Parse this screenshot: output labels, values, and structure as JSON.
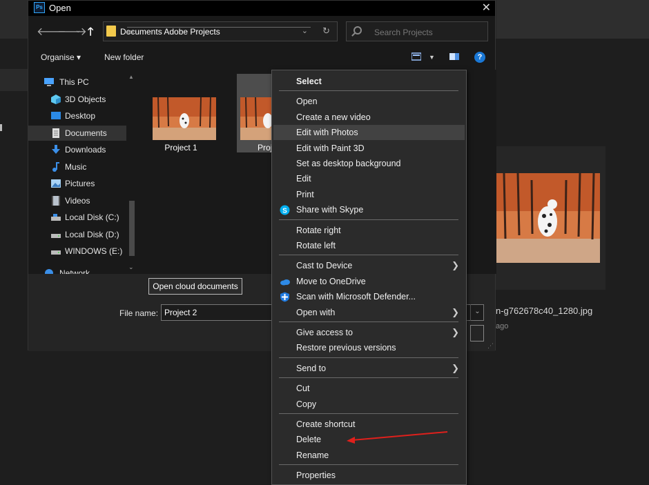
{
  "dialog": {
    "title": "Open",
    "close_symbol": "✕",
    "breadcrumb": [
      "Documents",
      "Adobe",
      "Projects"
    ],
    "crumb_prefix": "«",
    "search_placeholder": "Search Projects",
    "organise_label": "Organise ▾",
    "new_folder_label": "New folder",
    "help_symbol": "?",
    "nav_items": [
      {
        "label": "This PC",
        "icon": "computer-icon"
      },
      {
        "label": "3D Objects",
        "icon": "cube-icon"
      },
      {
        "label": "Desktop",
        "icon": "desktop-icon"
      },
      {
        "label": "Documents",
        "icon": "document-icon",
        "selected": true
      },
      {
        "label": "Downloads",
        "icon": "download-icon"
      },
      {
        "label": "Music",
        "icon": "music-icon"
      },
      {
        "label": "Pictures",
        "icon": "pictures-icon"
      },
      {
        "label": "Videos",
        "icon": "video-icon"
      },
      {
        "label": "Local Disk (C:)",
        "icon": "drive-icon"
      },
      {
        "label": "Local Disk (D:)",
        "icon": "drive-icon"
      },
      {
        "label": "WINDOWS (E:)",
        "icon": "drive-icon"
      },
      {
        "label": "Network",
        "icon": "network-icon"
      }
    ],
    "files": [
      {
        "name": "Project 1"
      },
      {
        "name": "Proj"
      }
    ],
    "cloud_button": "Open cloud documents",
    "file_name_label": "File name:",
    "file_name_value": "Project 2"
  },
  "context_menu": {
    "groups": [
      [
        {
          "label": "Select",
          "bold": true
        }
      ],
      [
        {
          "label": "Open"
        },
        {
          "label": "Create a new video"
        },
        {
          "label": "Edit with Photos",
          "highlighted": true
        },
        {
          "label": "Edit with Paint 3D"
        },
        {
          "label": "Set as desktop background"
        },
        {
          "label": "Edit"
        },
        {
          "label": "Print"
        },
        {
          "label": "Share with Skype",
          "icon": "skype-icon"
        }
      ],
      [
        {
          "label": "Rotate right"
        },
        {
          "label": "Rotate left"
        }
      ],
      [
        {
          "label": "Cast to Device",
          "submenu": true
        },
        {
          "label": "Move to OneDrive",
          "icon": "onedrive-icon"
        },
        {
          "label": "Scan with Microsoft Defender...",
          "icon": "defender-icon"
        },
        {
          "label": "Open with",
          "submenu": true
        }
      ],
      [
        {
          "label": "Give access to",
          "submenu": true
        },
        {
          "label": "Restore previous versions"
        }
      ],
      [
        {
          "label": "Send to",
          "submenu": true
        }
      ],
      [
        {
          "label": "Cut"
        },
        {
          "label": "Copy"
        }
      ],
      [
        {
          "label": "Create shortcut"
        },
        {
          "label": "Delete"
        },
        {
          "label": "Rename"
        }
      ],
      [
        {
          "label": "Properties"
        }
      ]
    ],
    "submenu_symbol": "❯"
  },
  "background": {
    "file_name": "n-g762678c40_1280.jpg",
    "file_sub": "ago"
  },
  "colors": {
    "accent": "#1a78d6",
    "annotation_arrow": "#e0201c",
    "menu_bg": "#2b2b2b"
  }
}
